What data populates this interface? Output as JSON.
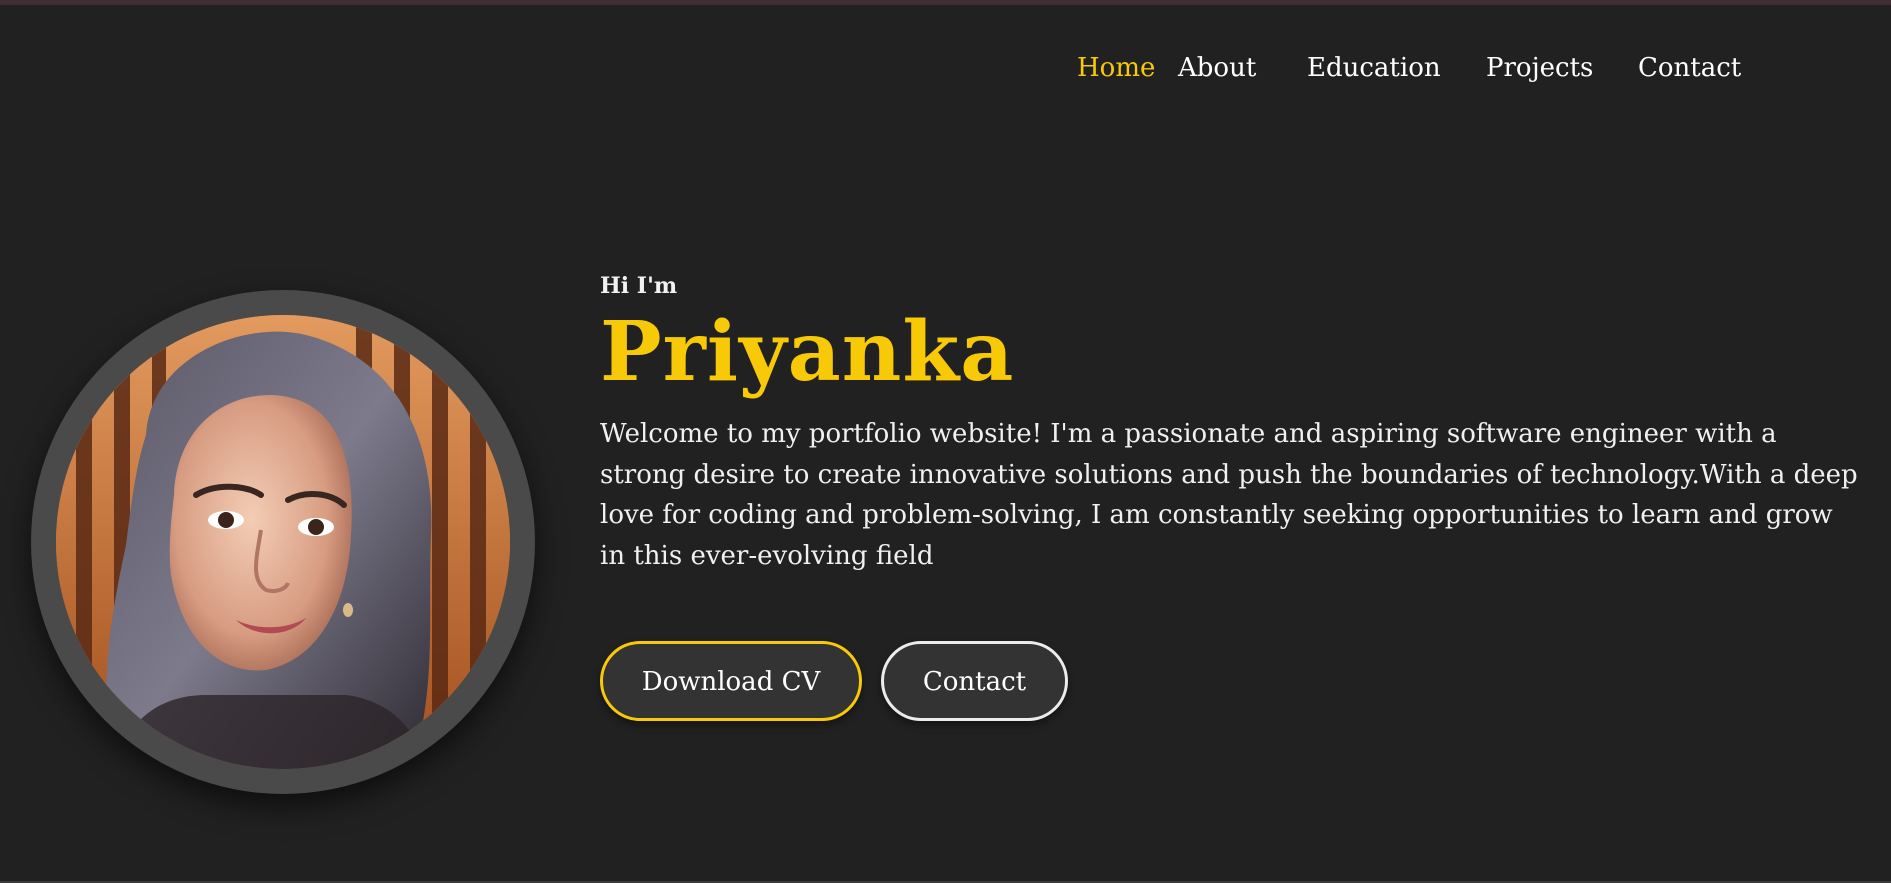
{
  "nav": {
    "items": [
      {
        "label": "Home",
        "active": true
      },
      {
        "label": "About",
        "active": false
      },
      {
        "label": "Education",
        "active": false
      },
      {
        "label": "Projects",
        "active": false
      },
      {
        "label": "Contact",
        "active": false
      }
    ]
  },
  "hero": {
    "greeting": "Hi I'm",
    "name": "Priyanka",
    "description": "Welcome to my portfolio website! I'm a passionate and aspiring software engineer with a strong desire to create innovative solutions and push the boundaries of technology.With a deep love for coding and problem-solving, I am constantly seeking opportunities to learn and grow in this ever-evolving field",
    "buttons": {
      "download_cv": "Download CV",
      "contact": "Contact"
    }
  },
  "colors": {
    "background": "#212121",
    "accent": "#f8c906",
    "text": "#ffffff",
    "button_bg": "#333333",
    "avatar_ring": "#4a4a4a"
  }
}
